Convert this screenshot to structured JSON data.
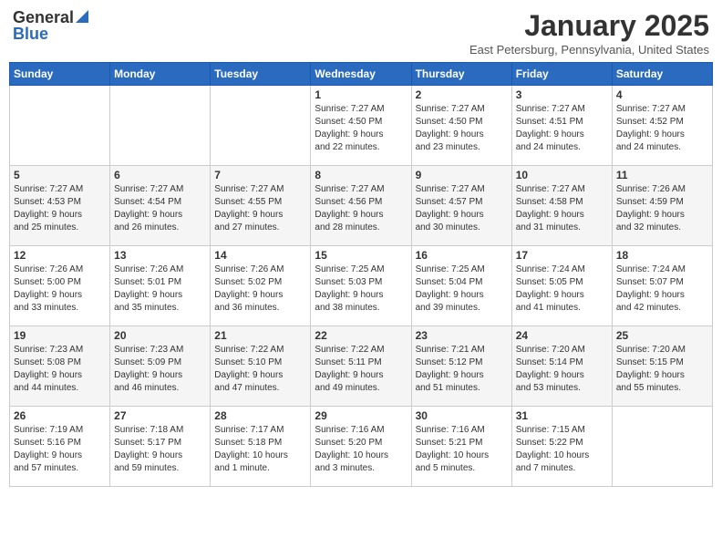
{
  "header": {
    "logo_general": "General",
    "logo_blue": "Blue",
    "month": "January 2025",
    "location": "East Petersburg, Pennsylvania, United States"
  },
  "days_of_week": [
    "Sunday",
    "Monday",
    "Tuesday",
    "Wednesday",
    "Thursday",
    "Friday",
    "Saturday"
  ],
  "weeks": [
    [
      {
        "day": "",
        "info": ""
      },
      {
        "day": "",
        "info": ""
      },
      {
        "day": "",
        "info": ""
      },
      {
        "day": "1",
        "info": "Sunrise: 7:27 AM\nSunset: 4:50 PM\nDaylight: 9 hours\nand 22 minutes."
      },
      {
        "day": "2",
        "info": "Sunrise: 7:27 AM\nSunset: 4:50 PM\nDaylight: 9 hours\nand 23 minutes."
      },
      {
        "day": "3",
        "info": "Sunrise: 7:27 AM\nSunset: 4:51 PM\nDaylight: 9 hours\nand 24 minutes."
      },
      {
        "day": "4",
        "info": "Sunrise: 7:27 AM\nSunset: 4:52 PM\nDaylight: 9 hours\nand 24 minutes."
      }
    ],
    [
      {
        "day": "5",
        "info": "Sunrise: 7:27 AM\nSunset: 4:53 PM\nDaylight: 9 hours\nand 25 minutes."
      },
      {
        "day": "6",
        "info": "Sunrise: 7:27 AM\nSunset: 4:54 PM\nDaylight: 9 hours\nand 26 minutes."
      },
      {
        "day": "7",
        "info": "Sunrise: 7:27 AM\nSunset: 4:55 PM\nDaylight: 9 hours\nand 27 minutes."
      },
      {
        "day": "8",
        "info": "Sunrise: 7:27 AM\nSunset: 4:56 PM\nDaylight: 9 hours\nand 28 minutes."
      },
      {
        "day": "9",
        "info": "Sunrise: 7:27 AM\nSunset: 4:57 PM\nDaylight: 9 hours\nand 30 minutes."
      },
      {
        "day": "10",
        "info": "Sunrise: 7:27 AM\nSunset: 4:58 PM\nDaylight: 9 hours\nand 31 minutes."
      },
      {
        "day": "11",
        "info": "Sunrise: 7:26 AM\nSunset: 4:59 PM\nDaylight: 9 hours\nand 32 minutes."
      }
    ],
    [
      {
        "day": "12",
        "info": "Sunrise: 7:26 AM\nSunset: 5:00 PM\nDaylight: 9 hours\nand 33 minutes."
      },
      {
        "day": "13",
        "info": "Sunrise: 7:26 AM\nSunset: 5:01 PM\nDaylight: 9 hours\nand 35 minutes."
      },
      {
        "day": "14",
        "info": "Sunrise: 7:26 AM\nSunset: 5:02 PM\nDaylight: 9 hours\nand 36 minutes."
      },
      {
        "day": "15",
        "info": "Sunrise: 7:25 AM\nSunset: 5:03 PM\nDaylight: 9 hours\nand 38 minutes."
      },
      {
        "day": "16",
        "info": "Sunrise: 7:25 AM\nSunset: 5:04 PM\nDaylight: 9 hours\nand 39 minutes."
      },
      {
        "day": "17",
        "info": "Sunrise: 7:24 AM\nSunset: 5:05 PM\nDaylight: 9 hours\nand 41 minutes."
      },
      {
        "day": "18",
        "info": "Sunrise: 7:24 AM\nSunset: 5:07 PM\nDaylight: 9 hours\nand 42 minutes."
      }
    ],
    [
      {
        "day": "19",
        "info": "Sunrise: 7:23 AM\nSunset: 5:08 PM\nDaylight: 9 hours\nand 44 minutes."
      },
      {
        "day": "20",
        "info": "Sunrise: 7:23 AM\nSunset: 5:09 PM\nDaylight: 9 hours\nand 46 minutes."
      },
      {
        "day": "21",
        "info": "Sunrise: 7:22 AM\nSunset: 5:10 PM\nDaylight: 9 hours\nand 47 minutes."
      },
      {
        "day": "22",
        "info": "Sunrise: 7:22 AM\nSunset: 5:11 PM\nDaylight: 9 hours\nand 49 minutes."
      },
      {
        "day": "23",
        "info": "Sunrise: 7:21 AM\nSunset: 5:12 PM\nDaylight: 9 hours\nand 51 minutes."
      },
      {
        "day": "24",
        "info": "Sunrise: 7:20 AM\nSunset: 5:14 PM\nDaylight: 9 hours\nand 53 minutes."
      },
      {
        "day": "25",
        "info": "Sunrise: 7:20 AM\nSunset: 5:15 PM\nDaylight: 9 hours\nand 55 minutes."
      }
    ],
    [
      {
        "day": "26",
        "info": "Sunrise: 7:19 AM\nSunset: 5:16 PM\nDaylight: 9 hours\nand 57 minutes."
      },
      {
        "day": "27",
        "info": "Sunrise: 7:18 AM\nSunset: 5:17 PM\nDaylight: 9 hours\nand 59 minutes."
      },
      {
        "day": "28",
        "info": "Sunrise: 7:17 AM\nSunset: 5:18 PM\nDaylight: 10 hours\nand 1 minute."
      },
      {
        "day": "29",
        "info": "Sunrise: 7:16 AM\nSunset: 5:20 PM\nDaylight: 10 hours\nand 3 minutes."
      },
      {
        "day": "30",
        "info": "Sunrise: 7:16 AM\nSunset: 5:21 PM\nDaylight: 10 hours\nand 5 minutes."
      },
      {
        "day": "31",
        "info": "Sunrise: 7:15 AM\nSunset: 5:22 PM\nDaylight: 10 hours\nand 7 minutes."
      },
      {
        "day": "",
        "info": ""
      }
    ]
  ]
}
